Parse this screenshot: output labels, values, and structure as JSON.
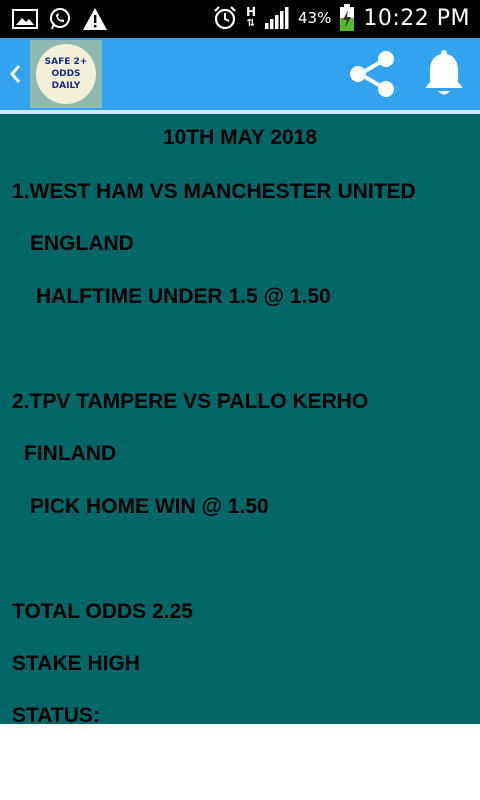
{
  "status_bar": {
    "battery_percent": "43%",
    "time": "10:22 PM",
    "network_label": "H",
    "left_icons": [
      "gallery-icon",
      "whatsapp-icon",
      "warning-icon"
    ],
    "right_icons": [
      "alarm-icon",
      "signal-icon",
      "battery-charging-icon"
    ]
  },
  "app_bar": {
    "logo_lines": [
      "SAFE 2+",
      "ODDS",
      "DAILY"
    ],
    "back_icon": "chevron-left-icon",
    "share_icon": "share-icon",
    "notification_icon": "bell-icon",
    "color": "#33a3f0"
  },
  "content": {
    "background": "#006666",
    "date": "10TH MAY 2018",
    "match1": {
      "title": "1.WEST HAM VS MANCHESTER UNITED",
      "country": "ENGLAND",
      "pick": "HALFTIME UNDER 1.5 @ 1.50"
    },
    "match2": {
      "title": "2.TPV TAMPERE VS PALLO KERHO",
      "country": "FINLAND",
      "pick": "PICK HOME WIN @ 1.50"
    },
    "total_odds": "TOTAL ODDS 2.25",
    "stake": "STAKE HIGH",
    "status": "STATUS:"
  }
}
